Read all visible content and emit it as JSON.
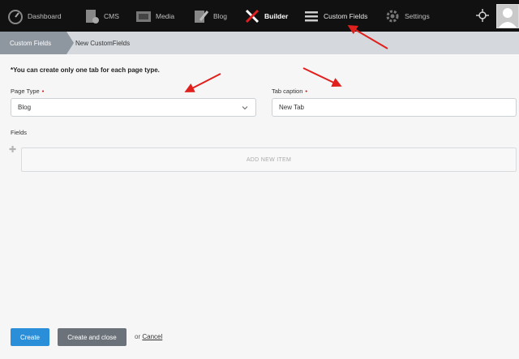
{
  "nav": {
    "items": [
      {
        "label": "Dashboard",
        "icon": "dashboard-icon"
      },
      {
        "label": "CMS",
        "icon": "cms-icon"
      },
      {
        "label": "Media",
        "icon": "media-icon"
      },
      {
        "label": "Blog",
        "icon": "blog-icon"
      },
      {
        "label": "Builder",
        "icon": "builder-icon"
      },
      {
        "label": "Custom Fields",
        "icon": "menu-icon"
      },
      {
        "label": "Settings",
        "icon": "gear-icon"
      }
    ]
  },
  "breadcrumb": {
    "first": "Custom Fields",
    "second": "New CustomFields"
  },
  "note": "*You can create only one tab for each page type.",
  "form": {
    "page_type_label": "Page Type",
    "page_type_value": "Blog",
    "tab_caption_label": "Tab caption",
    "tab_caption_value": "New Tab",
    "fields_label": "Fields",
    "add_item_label": "ADD NEW ITEM"
  },
  "actions": {
    "create": "Create",
    "create_close": "Create and close",
    "or": "or",
    "cancel": "Cancel"
  },
  "colors": {
    "annotation_arrow": "#e0201d",
    "accent": "#2a8ed8"
  }
}
